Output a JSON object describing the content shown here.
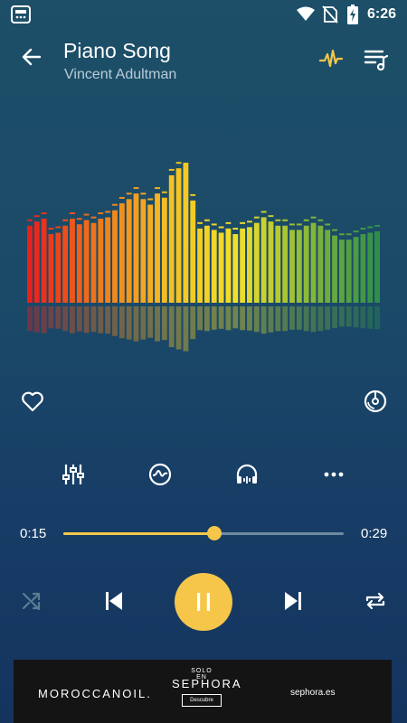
{
  "status_bar": {
    "time": "6:26",
    "app_icon": "radio-icon",
    "wifi_icon": "wifi-icon",
    "signal_icon": "no-sim-icon",
    "battery_icon": "battery-charging-icon"
  },
  "header": {
    "title": "Piano Song",
    "artist": "Vincent Adultman",
    "back_icon": "arrow-left-icon",
    "visualizer_icon": "pulse-icon",
    "queue_icon": "playlist-icon"
  },
  "equalizer": {
    "bar_levels": [
      0.55,
      0.58,
      0.6,
      0.49,
      0.5,
      0.55,
      0.6,
      0.56,
      0.59,
      0.57,
      0.6,
      0.61,
      0.66,
      0.71,
      0.74,
      0.78,
      0.74,
      0.7,
      0.78,
      0.75,
      0.91,
      0.96,
      1.0,
      0.73,
      0.53,
      0.55,
      0.52,
      0.5,
      0.53,
      0.49,
      0.53,
      0.54,
      0.57,
      0.61,
      0.58,
      0.55,
      0.55,
      0.52,
      0.52,
      0.55,
      0.57,
      0.55,
      0.52,
      0.48,
      0.45,
      0.45,
      0.47,
      0.49,
      0.5,
      0.51
    ],
    "colors": [
      "#e8201c",
      "#f07a1a",
      "#f4c023",
      "#f2df2a",
      "#8ab838",
      "#2f8f4a"
    ]
  },
  "actions": {
    "like_icon": "heart-icon",
    "disc_icon": "disc-icon"
  },
  "tools": {
    "equalizer_icon": "sliders-icon",
    "effects_icon": "waveform-icon",
    "headphones_icon": "headphones-icon",
    "more_icon": "more-icon"
  },
  "progress": {
    "current": "0:15",
    "total": "0:29",
    "fraction": 0.54,
    "accent": "#f5c64a"
  },
  "controls": {
    "shuffle_icon": "shuffle-icon",
    "previous_icon": "skip-previous-icon",
    "pause_icon": "pause-icon",
    "next_icon": "skip-next-icon",
    "repeat_icon": "repeat-icon"
  },
  "ad": {
    "brand": "MOROCCANOIL.",
    "tagline": "SOLO EN",
    "store": "SEPHORA",
    "cta": "Descubre",
    "domain": "sephora.es"
  }
}
